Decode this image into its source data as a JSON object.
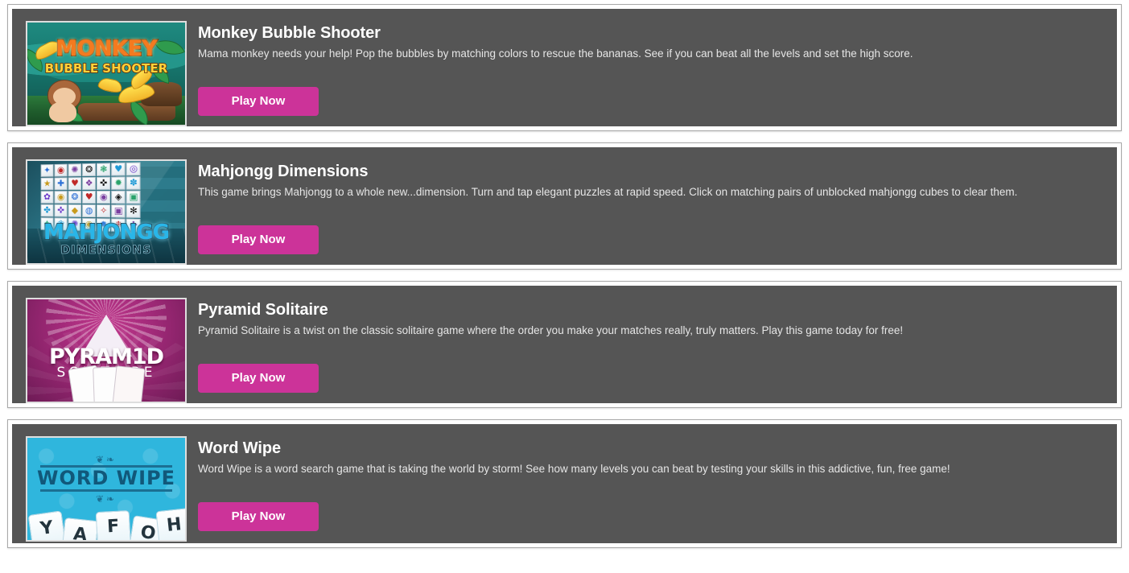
{
  "page": {
    "background": "#ffffff",
    "card_background": "#555555",
    "card_border": "#a8a8a8",
    "accent": "#cc3399",
    "title_color": "#ffffff",
    "description_color": "#e6e6e6"
  },
  "games": [
    {
      "title": "Monkey Bubble Shooter",
      "description": "Mama monkey needs your help! Pop the bubbles by matching colors to rescue the bananas. See if you can beat all the levels and set the high score.",
      "button_label": "Play Now",
      "thumbnail": {
        "name": "monkey-bubble-shooter-thumbnail",
        "title_line1": "MONKEY",
        "title_line2": "BUBBLE SHOOTER"
      }
    },
    {
      "title": "Mahjongg Dimensions",
      "description": "This game brings Mahjongg to a whole new...dimension. Turn and tap elegant puzzles at rapid speed. Click on matching pairs of unblocked mahjongg cubes to clear them.",
      "button_label": "Play Now",
      "thumbnail": {
        "name": "mahjongg-dimensions-thumbnail",
        "title_line1": "MAHJONGG",
        "title_line2": "DIMENSIONS",
        "tile_glyphs": [
          "✦",
          "◉",
          "✺",
          "❂",
          "❃",
          "♥",
          "◎",
          "★",
          "✚",
          "♥",
          "❖",
          "✜",
          "✹",
          "✽",
          "✿",
          "◉",
          "❂",
          "♥",
          "◉",
          "◈",
          "▣",
          "✤",
          "✜",
          "◆",
          "◍",
          "✧",
          "▣",
          "✻",
          "✦",
          "❀",
          "✺",
          "◉",
          "✹",
          "❉",
          "✚"
        ]
      }
    },
    {
      "title": "Pyramid Solitaire",
      "description": "Pyramid Solitaire is a twist on the classic solitaire game where the order you make your matches really, truly matters. Play this game today for free!",
      "button_label": "Play Now",
      "thumbnail": {
        "name": "pyramid-solitaire-thumbnail",
        "title_line1": "PYRAM1D",
        "title_line2": "SOLITAIRE"
      }
    },
    {
      "title": "Word Wipe",
      "description": "Word Wipe is a word search game that is taking the world by storm! See how many levels you can beat by testing your skills in this addictive, fun, free game!",
      "button_label": "Play Now",
      "thumbnail": {
        "name": "word-wipe-thumbnail",
        "title_line1": "WORD WIPE",
        "tile_letters": [
          "Y",
          "A",
          "F",
          "O",
          "H"
        ]
      }
    }
  ]
}
